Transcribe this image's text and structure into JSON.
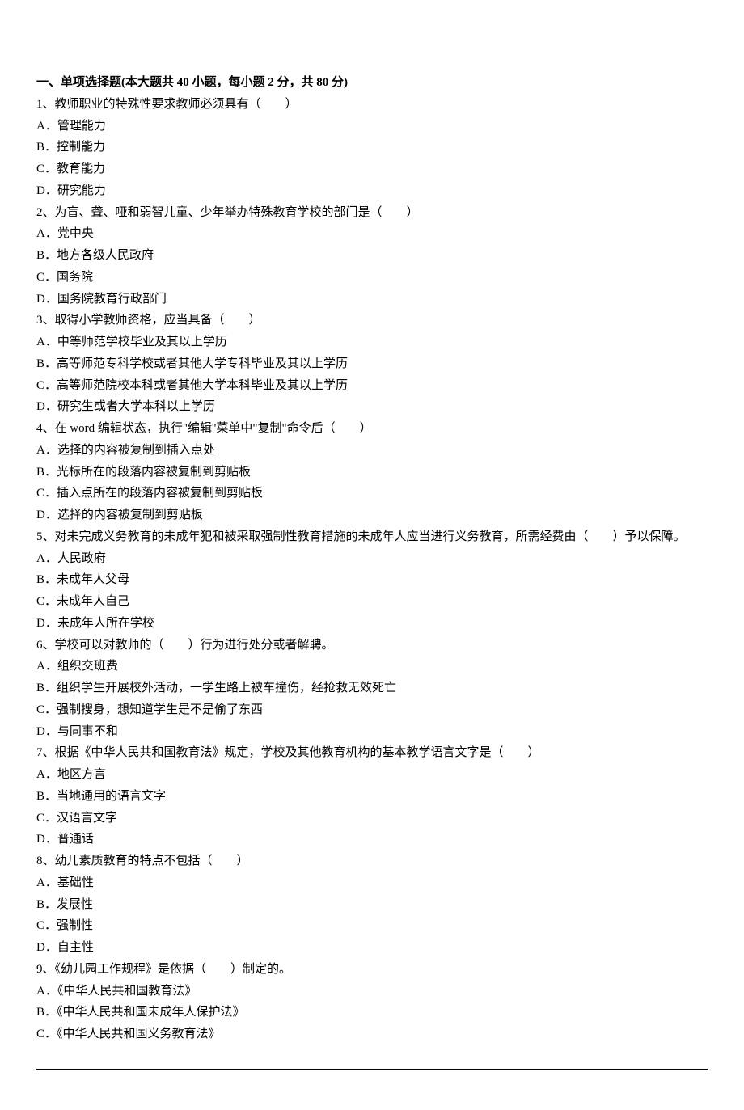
{
  "heading": "一、单项选择题(本大题共 40 小题，每小题 2 分，共 80 分)",
  "questions": [
    {
      "stem": "1、教师职业的特殊性要求教师必须具有（　　）",
      "opts": [
        "A．管理能力",
        "B．控制能力",
        "C．教育能力",
        "D．研究能力"
      ]
    },
    {
      "stem": "2、为盲、聋、哑和弱智儿童、少年举办特殊教育学校的部门是（　　）",
      "opts": [
        "A．党中央",
        "B．地方各级人民政府",
        "C．国务院",
        "D．国务院教育行政部门"
      ]
    },
    {
      "stem": "3、取得小学教师资格，应当具备（　　）",
      "opts": [
        "A．中等师范学校毕业及其以上学历",
        "B．高等师范专科学校或者其他大学专科毕业及其以上学历",
        "C．高等师范院校本科或者其他大学本科毕业及其以上学历",
        "D．研究生或者大学本科以上学历"
      ]
    },
    {
      "stem": "4、在 word 编辑状态，执行\"编辑''菜单中\"复制\"命令后（　　）",
      "opts": [
        "A．选择的内容被复制到插入点处",
        "B．光标所在的段落内容被复制到剪贴板",
        "C．插入点所在的段落内容被复制到剪贴板",
        "D．选择的内容被复制到剪贴板"
      ]
    },
    {
      "stem": "5、对未完成义务教育的未成年犯和被采取强制性教育措施的未成年人应当进行义务教育，所需经费由（　　）予以保障。",
      "opts": [
        "A．人民政府",
        "B．未成年人父母",
        "C．未成年人自己",
        "D．未成年人所在学校"
      ]
    },
    {
      "stem": "6、学校可以对教师的（　　）行为进行处分或者解聘。",
      "opts": [
        "A．组织交班费",
        "B．组织学生开展校外活动，一学生路上被车撞伤，经抢救无效死亡",
        "C．强制搜身，想知道学生是不是偷了东西",
        "D．与同事不和"
      ]
    },
    {
      "stem": "7、根据《中华人民共和国教育法》规定，学校及其他教育机构的基本教学语言文字是（　　）",
      "opts": [
        "A．地区方言",
        "B．当地通用的语言文字",
        "C．汉语言文字",
        "D．普通话"
      ]
    },
    {
      "stem": "8、幼儿素质教育的特点不包括（　　）",
      "opts": [
        "A．基础性",
        "B．发展性",
        "C．强制性",
        "D．自主性"
      ]
    },
    {
      "stem": "9、《幼儿园工作规程》是依据（　　）制定的。",
      "opts": [
        "A．《中华人民共和国教育法》",
        "B．《中华人民共和国未成年人保护法》",
        "C．《中华人民共和国义务教育法》"
      ]
    }
  ]
}
